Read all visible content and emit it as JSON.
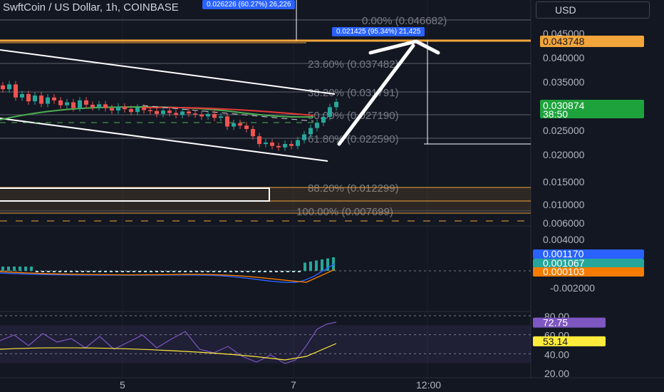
{
  "header": {
    "title": "SwftCoin / US Dollar, 1h, COINBASE"
  },
  "currency": {
    "label": "USD"
  },
  "badges": {
    "top": "0.026226 (60.27%) 26,226",
    "target": "0.021425 (95.34%) 21,425"
  },
  "colors": {
    "up": "#26a69a",
    "down": "#ef5350",
    "fib_band": "#f2a53a",
    "accent": "#2962ff",
    "rsi": "#7e57c2",
    "rsi_ma": "#ffeb3b"
  },
  "chart_data": [
    {
      "type": "candlestick",
      "title": "SwftCoin / US Dollar, 1h, COINBASE",
      "yaxis_ticks": [
        "0.045000",
        "0.040000",
        "0.035000",
        "0.030000",
        "0.025000",
        "0.020000",
        "0.015000",
        "0.010000",
        "0.006000"
      ],
      "xaxis_ticks": [
        "5",
        "7",
        "12:00"
      ],
      "fib_levels": [
        {
          "label": "0.00% (0.046682)",
          "value": 0.046682
        },
        {
          "label": "23.60% (0.037482)",
          "value": 0.037482
        },
        {
          "label": "38.20% (0.031791)",
          "value": 0.031791
        },
        {
          "label": "50.00% (0.027190)",
          "value": 0.02719
        },
        {
          "label": "61.80% (0.022590)",
          "value": 0.02259
        },
        {
          "label": "88.20% (0.012299)",
          "value": 0.012299
        },
        {
          "label": "100.00% (0.007699)",
          "value": 0.007699
        }
      ],
      "price_labels": [
        {
          "text": "0.043748",
          "color": "#f2a53a",
          "text_color": "#131722",
          "value": 0.043748
        },
        {
          "text": "0.030874\n38:50",
          "color": "#1ea33c",
          "text_color": "#ffffff",
          "value": 0.030874
        }
      ],
      "close_series": [
        0.0335,
        0.0345,
        0.0318,
        0.0325,
        0.031,
        0.0322,
        0.0305,
        0.0318,
        0.0312,
        0.0302,
        0.0308,
        0.0296,
        0.0312,
        0.0303,
        0.0298,
        0.0304,
        0.0296,
        0.0291,
        0.0299,
        0.0294,
        0.0288,
        0.0297,
        0.0292,
        0.029,
        0.0284,
        0.0291,
        0.0286,
        0.0282,
        0.0289,
        0.0285,
        0.0283,
        0.0279,
        0.0284,
        0.0276,
        0.0279,
        0.0258,
        0.0265,
        0.026,
        0.0253,
        0.0238,
        0.0222,
        0.0225,
        0.0218,
        0.0215,
        0.0222,
        0.0218,
        0.023,
        0.0242,
        0.0255,
        0.0266,
        0.0278,
        0.0298,
        0.0309
      ]
    },
    {
      "type": "histogram",
      "title": "MACD",
      "yaxis_ticks": [
        "0.004000",
        "0.002000",
        "-0.002000"
      ],
      "labels": [
        {
          "text": "0.001170",
          "color": "#2962ff"
        },
        {
          "text": "0.001067",
          "color": "#26a69a"
        },
        {
          "text": "0.000103",
          "color": "#f57c00"
        }
      ]
    },
    {
      "type": "line",
      "title": "RSI",
      "yaxis_ticks": [
        "80.00",
        "60.00",
        "40.00",
        "20.00"
      ],
      "ylim": [
        20,
        80
      ],
      "labels": [
        {
          "text": "72.75",
          "color": "#7e57c2",
          "value": 72.75
        },
        {
          "text": "53.14",
          "color": "#ffeb3b",
          "value": 53.14
        }
      ]
    }
  ]
}
